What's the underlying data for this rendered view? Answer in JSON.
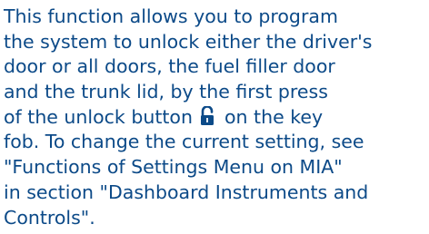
{
  "paragraph": {
    "lines": [
      "This function allows you to program",
      "the system to unlock either the driver's",
      "door or all doors, the fuel filler door",
      "and the trunk lid, by the first press",
      "of the unlock button",
      "on the key",
      "fob. To change the current setting, see",
      "\"Functions of Settings Menu on MIA\"",
      "in section \"Dashboard Instruments and",
      "Controls\"."
    ]
  },
  "icons": {
    "unlock": "unlock-padlock-icon"
  },
  "colors": {
    "text": "#0c4a88",
    "background": "#ffffff"
  }
}
